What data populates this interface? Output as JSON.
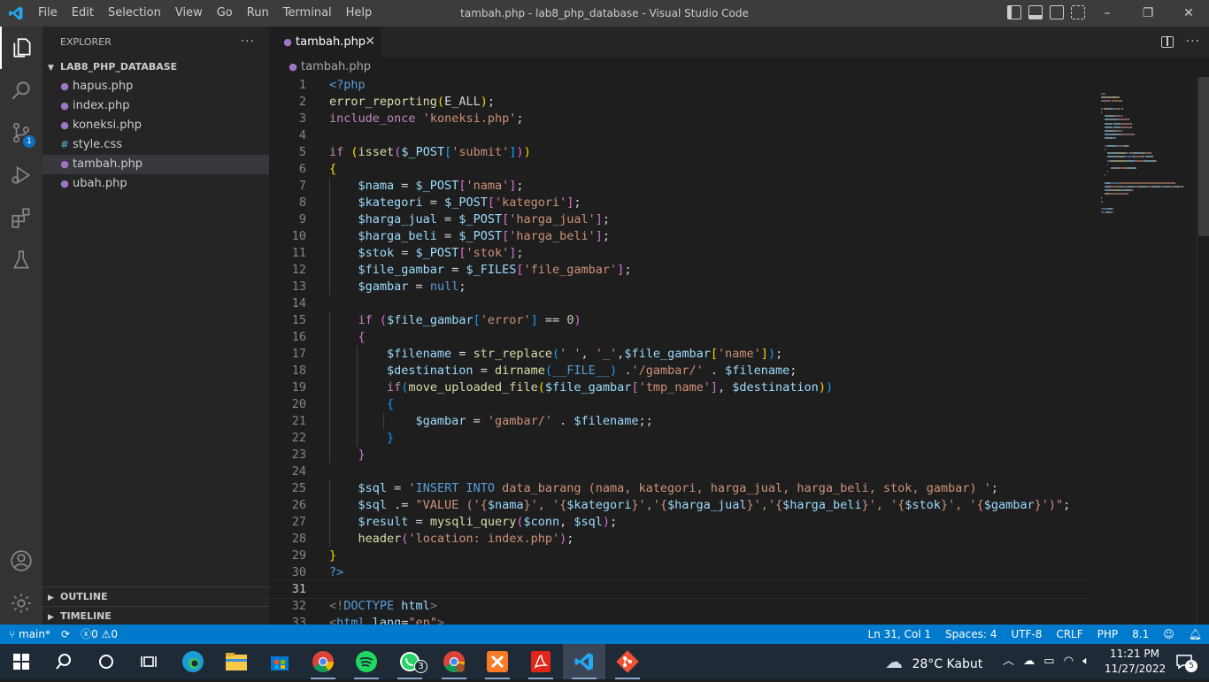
{
  "window": {
    "title": "tambah.php - lab8_php_database - Visual Studio Code",
    "menu": [
      "File",
      "Edit",
      "Selection",
      "View",
      "Go",
      "Run",
      "Terminal",
      "Help"
    ],
    "controls": [
      "–",
      "❐",
      "✕"
    ]
  },
  "activity_bar": {
    "source_control_badge": "1"
  },
  "explorer": {
    "header": "EXPLORER",
    "more": "···",
    "folder": "LAB8_PHP_DATABASE",
    "files": [
      {
        "name": "hapus.php",
        "icon": "php-elephant-icon"
      },
      {
        "name": "index.php",
        "icon": "php-elephant-icon"
      },
      {
        "name": "koneksi.php",
        "icon": "php-elephant-icon"
      },
      {
        "name": "style.css",
        "icon": "css-hash-icon"
      },
      {
        "name": "tambah.php",
        "icon": "php-elephant-icon",
        "selected": true
      },
      {
        "name": "ubah.php",
        "icon": "php-elephant-icon"
      }
    ],
    "outline": "OUTLINE",
    "timeline": "TIMELINE"
  },
  "editor": {
    "tab": "tambah.php",
    "breadcrumb": "tambah.php",
    "current_line": 31,
    "lines": [
      [
        [
          "<?php",
          "#569cd6"
        ]
      ],
      [
        [
          "error_reporting",
          "#dcdcaa"
        ],
        [
          "(",
          "#ffd700"
        ],
        [
          "E_ALL",
          "#d4d4d4"
        ],
        [
          ")",
          "#ffd700"
        ],
        [
          ";",
          "#d4d4d4"
        ]
      ],
      [
        [
          "include_once",
          "#c586c0"
        ],
        [
          " ",
          "#d4d4d4"
        ],
        [
          "'koneksi.php'",
          "#ce9178"
        ],
        [
          ";",
          "#d4d4d4"
        ]
      ],
      [],
      [
        [
          "if",
          "#c586c0"
        ],
        [
          " ",
          "#d4d4d4"
        ],
        [
          "(",
          "#ffd700"
        ],
        [
          "isset",
          "#dcdcaa"
        ],
        [
          "(",
          "#da70d6"
        ],
        [
          "$_POST",
          "#9cdcfe"
        ],
        [
          "[",
          "#179fff"
        ],
        [
          "'submit'",
          "#ce9178"
        ],
        [
          "]",
          "#179fff"
        ],
        [
          ")",
          "#da70d6"
        ],
        [
          ")",
          "#ffd700"
        ]
      ],
      [
        [
          "{",
          "#ffd700"
        ]
      ],
      [
        [
          "    ",
          "#d4d4d4"
        ],
        [
          "$nama",
          "#9cdcfe"
        ],
        [
          " = ",
          "#d4d4d4"
        ],
        [
          "$_POST",
          "#9cdcfe"
        ],
        [
          "[",
          "#da70d6"
        ],
        [
          "'nama'",
          "#ce9178"
        ],
        [
          "]",
          "#da70d6"
        ],
        [
          ";",
          "#d4d4d4"
        ]
      ],
      [
        [
          "    ",
          "#d4d4d4"
        ],
        [
          "$kategori",
          "#9cdcfe"
        ],
        [
          " = ",
          "#d4d4d4"
        ],
        [
          "$_POST",
          "#9cdcfe"
        ],
        [
          "[",
          "#da70d6"
        ],
        [
          "'kategori'",
          "#ce9178"
        ],
        [
          "]",
          "#da70d6"
        ],
        [
          ";",
          "#d4d4d4"
        ]
      ],
      [
        [
          "    ",
          "#d4d4d4"
        ],
        [
          "$harga_jual",
          "#9cdcfe"
        ],
        [
          " = ",
          "#d4d4d4"
        ],
        [
          "$_POST",
          "#9cdcfe"
        ],
        [
          "[",
          "#da70d6"
        ],
        [
          "'harga_jual'",
          "#ce9178"
        ],
        [
          "]",
          "#da70d6"
        ],
        [
          ";",
          "#d4d4d4"
        ]
      ],
      [
        [
          "    ",
          "#d4d4d4"
        ],
        [
          "$harga_beli",
          "#9cdcfe"
        ],
        [
          " = ",
          "#d4d4d4"
        ],
        [
          "$_POST",
          "#9cdcfe"
        ],
        [
          "[",
          "#da70d6"
        ],
        [
          "'harga_beli'",
          "#ce9178"
        ],
        [
          "]",
          "#da70d6"
        ],
        [
          ";",
          "#d4d4d4"
        ]
      ],
      [
        [
          "    ",
          "#d4d4d4"
        ],
        [
          "$stok",
          "#9cdcfe"
        ],
        [
          " = ",
          "#d4d4d4"
        ],
        [
          "$_POST",
          "#9cdcfe"
        ],
        [
          "[",
          "#da70d6"
        ],
        [
          "'stok'",
          "#ce9178"
        ],
        [
          "]",
          "#da70d6"
        ],
        [
          ";",
          "#d4d4d4"
        ]
      ],
      [
        [
          "    ",
          "#d4d4d4"
        ],
        [
          "$file_gambar",
          "#9cdcfe"
        ],
        [
          " = ",
          "#d4d4d4"
        ],
        [
          "$_FILES",
          "#9cdcfe"
        ],
        [
          "[",
          "#da70d6"
        ],
        [
          "'file_gambar'",
          "#ce9178"
        ],
        [
          "]",
          "#da70d6"
        ],
        [
          ";",
          "#d4d4d4"
        ]
      ],
      [
        [
          "    ",
          "#d4d4d4"
        ],
        [
          "$gambar",
          "#9cdcfe"
        ],
        [
          " = ",
          "#d4d4d4"
        ],
        [
          "null",
          "#569cd6"
        ],
        [
          ";",
          "#d4d4d4"
        ]
      ],
      [],
      [
        [
          "    ",
          "#d4d4d4"
        ],
        [
          "if",
          "#c586c0"
        ],
        [
          " ",
          "#d4d4d4"
        ],
        [
          "(",
          "#da70d6"
        ],
        [
          "$file_gambar",
          "#9cdcfe"
        ],
        [
          "[",
          "#179fff"
        ],
        [
          "'error'",
          "#ce9178"
        ],
        [
          "]",
          "#179fff"
        ],
        [
          " == ",
          "#d4d4d4"
        ],
        [
          "0",
          "#b5cea8"
        ],
        [
          ")",
          "#da70d6"
        ]
      ],
      [
        [
          "    ",
          "#d4d4d4"
        ],
        [
          "{",
          "#da70d6"
        ]
      ],
      [
        [
          "        ",
          "#d4d4d4"
        ],
        [
          "$filename",
          "#9cdcfe"
        ],
        [
          " = ",
          "#d4d4d4"
        ],
        [
          "str_replace",
          "#dcdcaa"
        ],
        [
          "(",
          "#179fff"
        ],
        [
          "' '",
          "#ce9178"
        ],
        [
          ", ",
          "#d4d4d4"
        ],
        [
          "'_'",
          "#ce9178"
        ],
        [
          ",",
          "#d4d4d4"
        ],
        [
          "$file_gambar",
          "#9cdcfe"
        ],
        [
          "[",
          "#ffd700"
        ],
        [
          "'name'",
          "#ce9178"
        ],
        [
          "]",
          "#ffd700"
        ],
        [
          ")",
          "#179fff"
        ],
        [
          ";",
          "#d4d4d4"
        ]
      ],
      [
        [
          "        ",
          "#d4d4d4"
        ],
        [
          "$destination",
          "#9cdcfe"
        ],
        [
          " = ",
          "#d4d4d4"
        ],
        [
          "dirname",
          "#dcdcaa"
        ],
        [
          "(",
          "#179fff"
        ],
        [
          "__FILE__",
          "#569cd6"
        ],
        [
          ")",
          "#179fff"
        ],
        [
          " .",
          "#d4d4d4"
        ],
        [
          "'/gambar/'",
          "#ce9178"
        ],
        [
          " . ",
          "#d4d4d4"
        ],
        [
          "$filename",
          "#9cdcfe"
        ],
        [
          ";",
          "#d4d4d4"
        ]
      ],
      [
        [
          "        ",
          "#d4d4d4"
        ],
        [
          "if",
          "#c586c0"
        ],
        [
          "(",
          "#179fff"
        ],
        [
          "move_uploaded_file",
          "#dcdcaa"
        ],
        [
          "(",
          "#ffd700"
        ],
        [
          "$file_gambar",
          "#9cdcfe"
        ],
        [
          "[",
          "#da70d6"
        ],
        [
          "'tmp_name'",
          "#ce9178"
        ],
        [
          "]",
          "#da70d6"
        ],
        [
          ", ",
          "#d4d4d4"
        ],
        [
          "$destination",
          "#9cdcfe"
        ],
        [
          ")",
          "#ffd700"
        ],
        [
          ")",
          "#179fff"
        ]
      ],
      [
        [
          "        ",
          "#d4d4d4"
        ],
        [
          "{",
          "#179fff"
        ]
      ],
      [
        [
          "            ",
          "#d4d4d4"
        ],
        [
          "$gambar",
          "#9cdcfe"
        ],
        [
          " = ",
          "#d4d4d4"
        ],
        [
          "'gambar/'",
          "#ce9178"
        ],
        [
          " . ",
          "#d4d4d4"
        ],
        [
          "$filename",
          "#9cdcfe"
        ],
        [
          ";;",
          "#d4d4d4"
        ]
      ],
      [
        [
          "        ",
          "#d4d4d4"
        ],
        [
          "}",
          "#179fff"
        ]
      ],
      [
        [
          "    ",
          "#d4d4d4"
        ],
        [
          "}",
          "#da70d6"
        ]
      ],
      [],
      [
        [
          "    ",
          "#d4d4d4"
        ],
        [
          "$sql",
          "#9cdcfe"
        ],
        [
          " = ",
          "#d4d4d4"
        ],
        [
          "'",
          "#ce9178"
        ],
        [
          "INSERT INTO",
          "#569cd6"
        ],
        [
          " data_barang (nama, kategori, harga_jual, harga_beli, stok, gambar) '",
          "#ce9178"
        ],
        [
          ";",
          "#d4d4d4"
        ]
      ],
      [
        [
          "    ",
          "#d4d4d4"
        ],
        [
          "$sql",
          "#9cdcfe"
        ],
        [
          " .= ",
          "#d4d4d4"
        ],
        [
          "\"VALUE ('{",
          "#ce9178"
        ],
        [
          "$nama",
          "#9cdcfe"
        ],
        [
          "}', '{",
          "#ce9178"
        ],
        [
          "$kategori",
          "#9cdcfe"
        ],
        [
          "}','{",
          "#ce9178"
        ],
        [
          "$harga_jual",
          "#9cdcfe"
        ],
        [
          "}','{",
          "#ce9178"
        ],
        [
          "$harga_beli",
          "#9cdcfe"
        ],
        [
          "}', '{",
          "#ce9178"
        ],
        [
          "$stok",
          "#9cdcfe"
        ],
        [
          "}', '{",
          "#ce9178"
        ],
        [
          "$gambar",
          "#9cdcfe"
        ],
        [
          "}')\"",
          "#ce9178"
        ],
        [
          ";",
          "#d4d4d4"
        ]
      ],
      [
        [
          "    ",
          "#d4d4d4"
        ],
        [
          "$result",
          "#9cdcfe"
        ],
        [
          " = ",
          "#d4d4d4"
        ],
        [
          "mysqli_query",
          "#dcdcaa"
        ],
        [
          "(",
          "#da70d6"
        ],
        [
          "$conn",
          "#9cdcfe"
        ],
        [
          ", ",
          "#d4d4d4"
        ],
        [
          "$sql",
          "#9cdcfe"
        ],
        [
          ")",
          "#da70d6"
        ],
        [
          ";",
          "#d4d4d4"
        ]
      ],
      [
        [
          "    ",
          "#d4d4d4"
        ],
        [
          "header",
          "#dcdcaa"
        ],
        [
          "(",
          "#da70d6"
        ],
        [
          "'location: index.php'",
          "#ce9178"
        ],
        [
          ")",
          "#da70d6"
        ],
        [
          ";",
          "#d4d4d4"
        ]
      ],
      [
        [
          "}",
          "#ffd700"
        ]
      ],
      [
        [
          "?>",
          "#569cd6"
        ]
      ],
      [],
      [
        [
          "<!",
          "#808080"
        ],
        [
          "DOCTYPE",
          "#569cd6"
        ],
        [
          " html",
          "#9cdcfe"
        ],
        [
          ">",
          "#808080"
        ]
      ],
      [
        [
          "<",
          "#808080"
        ],
        [
          "html",
          "#569cd6"
        ],
        [
          " lang",
          "#9cdcfe"
        ],
        [
          "=",
          "#d4d4d4"
        ],
        [
          "\"en\"",
          "#ce9178"
        ],
        [
          ">",
          "#808080"
        ]
      ]
    ]
  },
  "status_bar": {
    "branch": "main*",
    "sync": "⟳",
    "errors": "0",
    "warnings": "0",
    "position": "Ln 31, Col 1",
    "spaces": "Spaces: 4",
    "encoding": "UTF-8",
    "eol": "CRLF",
    "language": "PHP",
    "version": "8.1"
  },
  "taskbar": {
    "weather": "28°C  Kabut",
    "time": "11:21 PM",
    "date": "11/27/2022",
    "whatsapp_badge": "3",
    "notification_badge": "5",
    "apps": [
      "windows-start-icon",
      "search-icon",
      "cortana-icon",
      "task-view-icon",
      "edge-icon",
      "file-explorer-icon",
      "microsoft-store-icon",
      "chrome-icon",
      "spotify-icon",
      "whatsapp-icon",
      "chrome-profile-icon",
      "xampp-icon",
      "acrobat-icon",
      "vscode-icon",
      "git-icon"
    ]
  }
}
